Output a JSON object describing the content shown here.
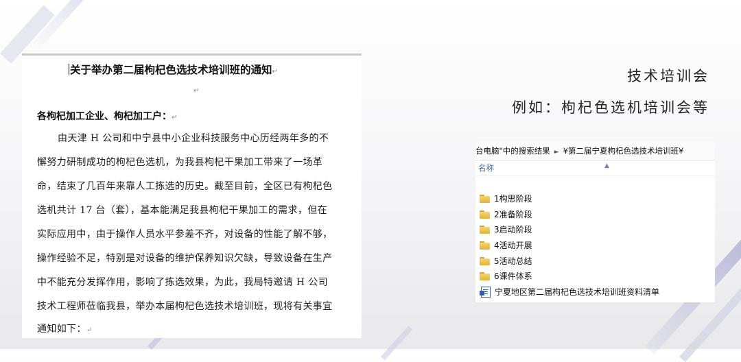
{
  "document": {
    "title": "关于举办第二届枸杞色选技术培训班的通知",
    "paragraph_mark": "↵",
    "greeting": "各枸杞加工企业、枸杞加工户：",
    "body_lines": [
      "由天津 H 公司和中宁县中小企业科技服务中心历经两年多的不",
      "懈努力研制成功的枸杞色选机，为我县枸杞干果加工带来了一场革",
      "命，结束了几百年来靠人工拣选的历史。截至目前，全区已有枸杞色",
      "选机共计 17 台（套），基本能满足我县枸杞干果加工的需求，但在",
      "实际应用中，由于操作人员水平参差不齐，对设备的性能了解不够，",
      "操作经验不足，特别是对设备的维护保养知识欠缺，导致设备在生产",
      "中不能充分发挥作用，影响了拣选效果，为此，我局特邀请 H 公司",
      "技术工程师莅临我县，举办本届枸杞色选技术培训班，现将有关事宜",
      "通知如下："
    ]
  },
  "headings": {
    "line1": "技术培训会",
    "line2": "例如：枸杞色选机培训会等"
  },
  "explorer": {
    "breadcrumb": [
      "台电脑\"中的搜索结果",
      "¥第二届宁夏枸杞色选技术培训班¥"
    ],
    "column_header": "名称",
    "items": [
      {
        "name": "1构思阶段",
        "type": "folder"
      },
      {
        "name": "2准备阶段",
        "type": "folder"
      },
      {
        "name": "3启动阶段",
        "type": "folder"
      },
      {
        "name": "4活动开展",
        "type": "folder"
      },
      {
        "name": "5活动总结",
        "type": "folder"
      },
      {
        "name": "6课件体系",
        "type": "folder"
      },
      {
        "name": "宁夏地区第二届枸杞色选技术培训班资料清单",
        "type": "word-document"
      }
    ]
  }
}
